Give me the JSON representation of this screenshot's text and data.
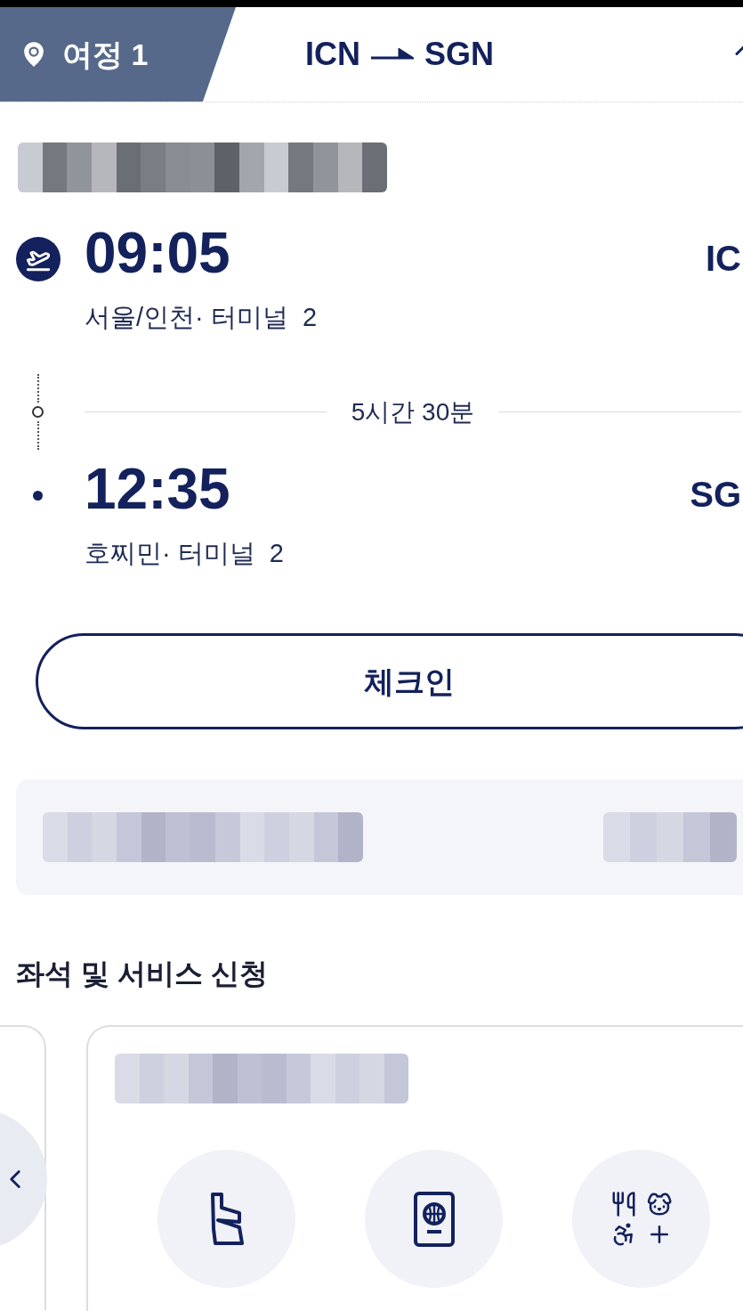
{
  "trip_tab": {
    "label": "여정 1"
  },
  "route": {
    "origin": "ICN",
    "destination": "SGN"
  },
  "segments": [
    {
      "kind": "departure",
      "time": "09:05",
      "place": "서울/인천· 터미널  2",
      "airport": "IC"
    },
    {
      "kind": "arrival",
      "time": "12:35",
      "place": "호찌민· 터미널  2",
      "airport": "SG"
    }
  ],
  "duration": "5시간 30분",
  "checkin_button": "체크인",
  "section_title": "좌석 및 서비스 신청",
  "services": [
    {
      "kind": "seat"
    },
    {
      "kind": "passport"
    },
    {
      "kind": "extras"
    }
  ]
}
